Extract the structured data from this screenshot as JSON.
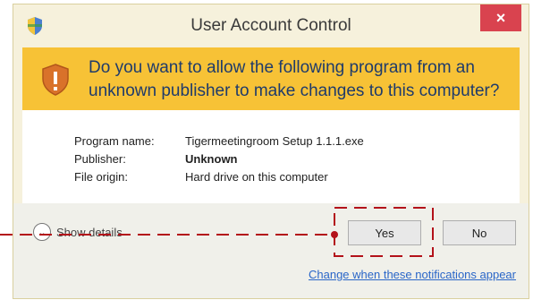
{
  "window": {
    "title": "User Account Control",
    "close_glyph": "×"
  },
  "banner": {
    "question": "Do you want to allow the following program from an unknown publisher to make changes to this computer?",
    "icon": "uac-shield-icon"
  },
  "details": {
    "program_name_label": "Program name:",
    "program_name_value": "Tigermeetingroom Setup 1.1.1.exe",
    "publisher_label": "Publisher:",
    "publisher_value": "Unknown",
    "file_origin_label": "File origin:",
    "file_origin_value": "Hard drive on this computer"
  },
  "footer": {
    "show_details_label": "Show details",
    "yes_label": "Yes",
    "no_label": "No",
    "change_link": "Change when these notifications appear"
  },
  "colors": {
    "banner": "#f7c236",
    "close_button": "#d9434f",
    "annotation": "#b3121a",
    "link": "#2a66c8"
  }
}
